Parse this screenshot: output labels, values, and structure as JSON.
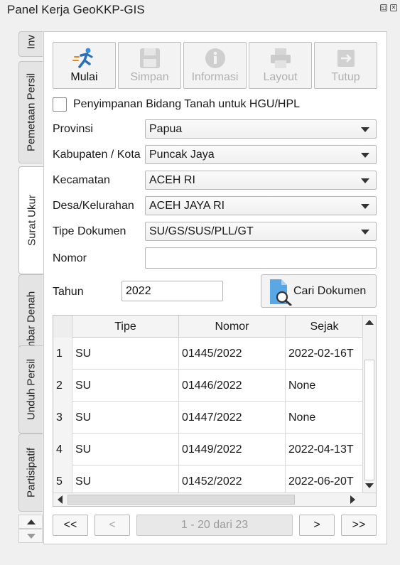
{
  "window": {
    "title": "Panel Kerja GeoKKP-GIS"
  },
  "tabs": [
    {
      "label": "Inv"
    },
    {
      "label": "Pemetaan Persil"
    },
    {
      "label": "Surat Ukur"
    },
    {
      "label": "Gambar Denah"
    },
    {
      "label": "Unduh Persil"
    },
    {
      "label": "Partisipatif"
    }
  ],
  "toolbar": {
    "start_label": "Mulai",
    "save_label": "Simpan",
    "info_label": "Informasi",
    "layout_label": "Layout",
    "close_label": "Tutup"
  },
  "form": {
    "hgu_checkbox_label": "Penyimpanan Bidang Tanah untuk HGU/HPL",
    "provinsi_label": "Provinsi",
    "provinsi_value": "Papua",
    "kabupaten_label": "Kabupaten / Kota",
    "kabupaten_value": "Puncak Jaya",
    "kecamatan_label": "Kecamatan",
    "kecamatan_value": "ACEH RI",
    "desa_label": "Desa/Kelurahan",
    "desa_value": "ACEH JAYA RI",
    "tipe_label": "Tipe Dokumen",
    "tipe_value": "SU/GS/SUS/PLL/GT",
    "nomor_label": "Nomor",
    "nomor_value": "",
    "tahun_label": "Tahun",
    "tahun_value": "2022",
    "search_label": "Cari Dokumen"
  },
  "table": {
    "headers": [
      "Tipe",
      "Nomor",
      "Sejak"
    ],
    "rows": [
      {
        "num": "1",
        "tipe": "SU",
        "nomor": "01445/2022",
        "sejak": "2022-02-16T"
      },
      {
        "num": "2",
        "tipe": "SU",
        "nomor": "01446/2022",
        "sejak": "None"
      },
      {
        "num": "3",
        "tipe": "SU",
        "nomor": "01447/2022",
        "sejak": "None"
      },
      {
        "num": "4",
        "tipe": "SU",
        "nomor": "01449/2022",
        "sejak": "2022-04-13T"
      },
      {
        "num": "5",
        "tipe": "SU",
        "nomor": "01452/2022",
        "sejak": "2022-06-20T"
      }
    ]
  },
  "pagination": {
    "first_label": "<<",
    "prev_label": "<",
    "info": "1 - 20 dari 23",
    "next_label": ">",
    "last_label": ">>"
  },
  "icons": {
    "start": "running-person-icon",
    "save": "floppy-disk-icon",
    "info": "info-circle-icon",
    "layout": "printer-icon",
    "close": "exit-icon",
    "search": "document-magnifier-icon"
  },
  "colors": {
    "accent_blue": "#3a8fd8",
    "disabled_gray": "#b0b0b0"
  }
}
